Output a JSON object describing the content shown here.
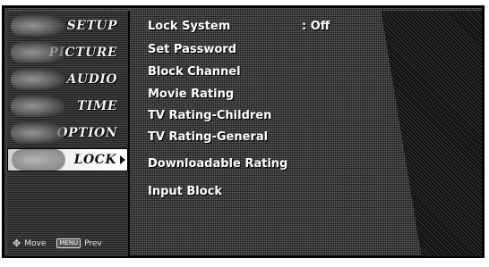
{
  "left_menu": {
    "items": [
      {
        "label": "SETUP",
        "icon": "setup-icon"
      },
      {
        "label": "PICTURE",
        "icon": "picture-icon"
      },
      {
        "label": "AUDIO",
        "icon": "audio-icon"
      },
      {
        "label": "TIME",
        "icon": "time-icon"
      },
      {
        "label": "OPTION",
        "icon": "option-icon"
      },
      {
        "label": "LOCK",
        "icon": "lock-icon",
        "selected": true
      }
    ]
  },
  "footer": {
    "move_label": "Move",
    "menu_key": "MENU",
    "prev_label": "Prev",
    "move_icon": "move-arrows-icon"
  },
  "options": {
    "lock_system": {
      "label": "Lock System",
      "value": ": Off"
    },
    "set_password": "Set Password",
    "block_channel": "Block Channel",
    "movie_rating": "Movie Rating",
    "tv_rating_children": "TV Rating-Children",
    "tv_rating_general": "TV Rating-General",
    "downloadable_rating": "Downloadable Rating",
    "input_block": "Input Block"
  }
}
